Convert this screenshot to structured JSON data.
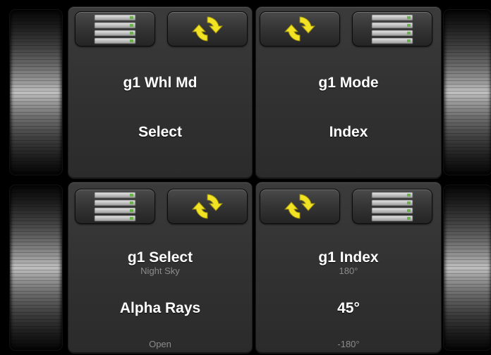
{
  "icons": {
    "list": "stacked-list-icon",
    "sync": "sync-arrows-icon"
  },
  "colors": {
    "sync_icon": "#f2e224",
    "list_green": "#6ab04c"
  },
  "panels": [
    {
      "title": "g1 Whl Md",
      "value": "Select"
    },
    {
      "title": "g1 Mode",
      "value": "Index"
    },
    {
      "title": "g1 Select",
      "upper": "Night Sky",
      "value": "Alpha Rays",
      "lower": "Open"
    },
    {
      "title": "g1 Index",
      "upper": "180°",
      "value": "45°",
      "lower": "-180°"
    }
  ]
}
